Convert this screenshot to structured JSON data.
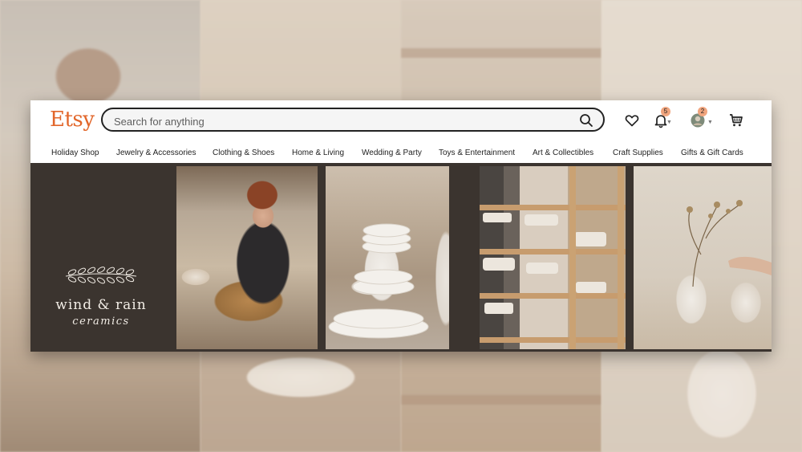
{
  "header": {
    "logo": "Etsy",
    "logo_color": "#e2662a",
    "search": {
      "placeholder": "Search for anything",
      "icon": "search-icon"
    },
    "icons": {
      "favorites": "heart-icon",
      "notifications": {
        "icon": "bell-icon",
        "badge": "5"
      },
      "account": {
        "icon": "avatar",
        "badge": "2"
      },
      "cart": "cart-icon"
    }
  },
  "nav": {
    "items": [
      "Holiday Shop",
      "Jewelry & Accessories",
      "Clothing & Shoes",
      "Home & Living",
      "Wedding & Party",
      "Toys & Entertainment",
      "Art & Collectibles",
      "Craft Supplies",
      "Gifts & Gift Cards"
    ]
  },
  "banner": {
    "brand_name": "wind & rain",
    "brand_sub": "ceramics",
    "panel_color": "#3b342f"
  }
}
